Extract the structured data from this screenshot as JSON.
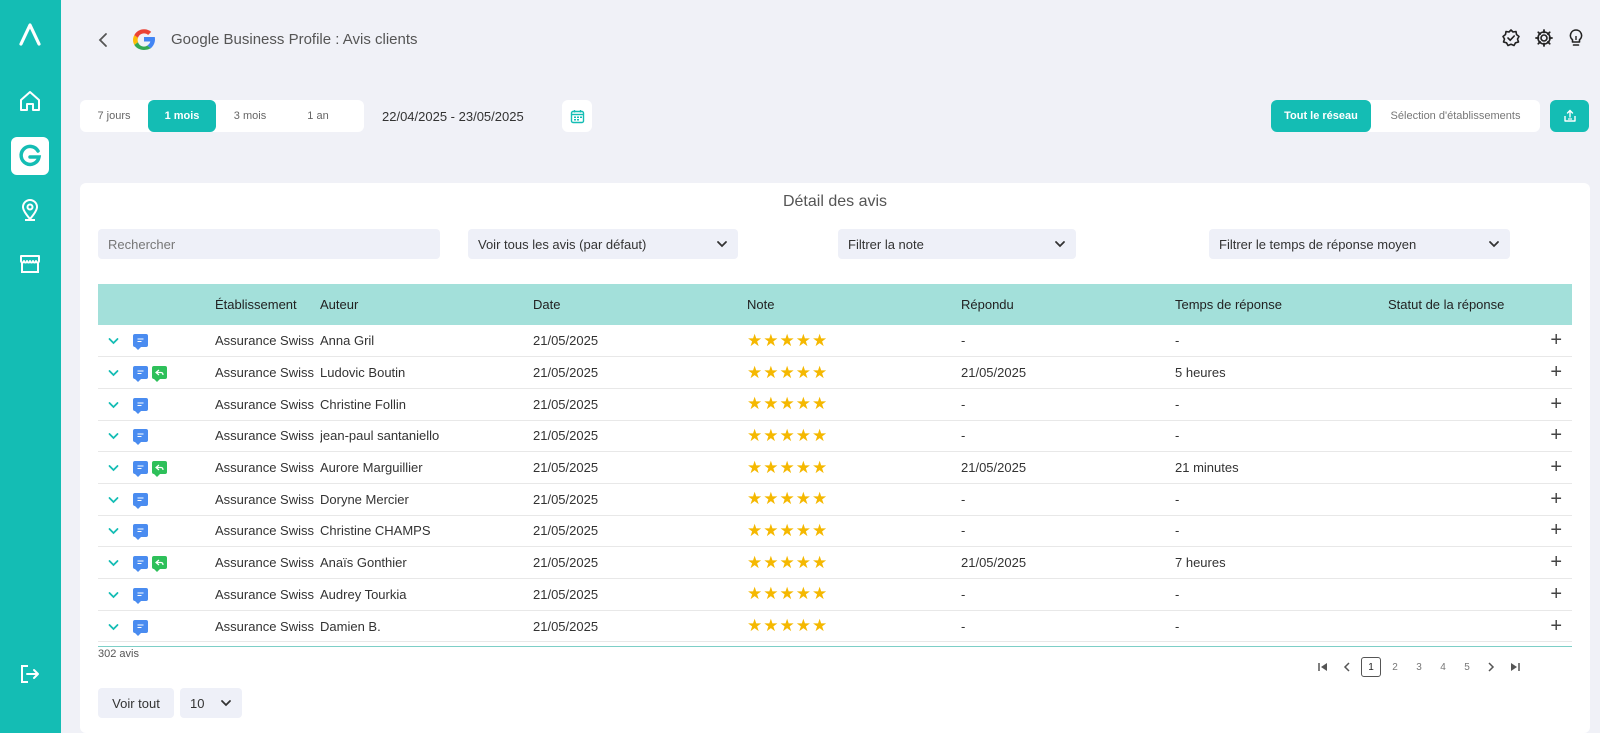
{
  "header": {
    "title": "Google Business Profile : Avis clients"
  },
  "periods": [
    {
      "label": "7 jours",
      "active": false
    },
    {
      "label": "1 mois",
      "active": true
    },
    {
      "label": "3 mois",
      "active": false
    },
    {
      "label": "1 an",
      "active": false
    }
  ],
  "date_range": "22/04/2025 - 23/05/2025",
  "network": {
    "all_label": "Tout le réseau",
    "selection_label": "Sélection d'établissements"
  },
  "card": {
    "title": "Détail des avis",
    "search_placeholder": "Rechercher",
    "filter_reviews": "Voir tous les avis (par défaut)",
    "filter_rating": "Filtrer la note",
    "filter_response_time": "Filtrer le temps de réponse moyen"
  },
  "table": {
    "headers": [
      "",
      "",
      "Établissement",
      "Auteur",
      "Date",
      "Note",
      "Répondu",
      "Temps de réponse",
      "Statut de la réponse"
    ],
    "rows": [
      {
        "replied": false,
        "etab": "Assurance Swiss",
        "author": "Anna Gril",
        "date": "21/05/2025",
        "stars": 5,
        "answered": "-",
        "time": "-"
      },
      {
        "replied": true,
        "etab": "Assurance Swiss",
        "author": "Ludovic Boutin",
        "date": "21/05/2025",
        "stars": 5,
        "answered": "21/05/2025",
        "time": "5 heures"
      },
      {
        "replied": false,
        "etab": "Assurance Swiss",
        "author": "Christine Follin",
        "date": "21/05/2025",
        "stars": 5,
        "answered": "-",
        "time": "-"
      },
      {
        "replied": false,
        "etab": "Assurance Swiss",
        "author": "jean-paul santaniello",
        "date": "21/05/2025",
        "stars": 5,
        "answered": "-",
        "time": "-"
      },
      {
        "replied": true,
        "etab": "Assurance Swiss",
        "author": "Aurore Marguillier",
        "date": "21/05/2025",
        "stars": 5,
        "answered": "21/05/2025",
        "time": "21 minutes"
      },
      {
        "replied": false,
        "etab": "Assurance Swiss",
        "author": "Doryne Mercier",
        "date": "21/05/2025",
        "stars": 5,
        "answered": "-",
        "time": "-"
      },
      {
        "replied": false,
        "etab": "Assurance Swiss",
        "author": "Christine CHAMPS",
        "date": "21/05/2025",
        "stars": 5,
        "answered": "-",
        "time": "-"
      },
      {
        "replied": true,
        "etab": "Assurance Swiss",
        "author": "Anaïs Gonthier",
        "date": "21/05/2025",
        "stars": 5,
        "answered": "21/05/2025",
        "time": "7 heures"
      },
      {
        "replied": false,
        "etab": "Assurance Swiss",
        "author": "Audrey Tourkia",
        "date": "21/05/2025",
        "stars": 5,
        "answered": "-",
        "time": "-"
      },
      {
        "replied": false,
        "etab": "Assurance Swiss",
        "author": "Damien B.",
        "date": "21/05/2025",
        "stars": 5,
        "answered": "-",
        "time": "-"
      }
    ]
  },
  "footer": {
    "count": "302 avis",
    "pages": [
      "1",
      "2",
      "3",
      "4",
      "5"
    ],
    "current_page": "1",
    "view_all": "Voir tout",
    "page_size": "10"
  },
  "colors": {
    "accent": "#14bdb4",
    "header_row": "#a3e0da",
    "star": "#f5b800"
  }
}
